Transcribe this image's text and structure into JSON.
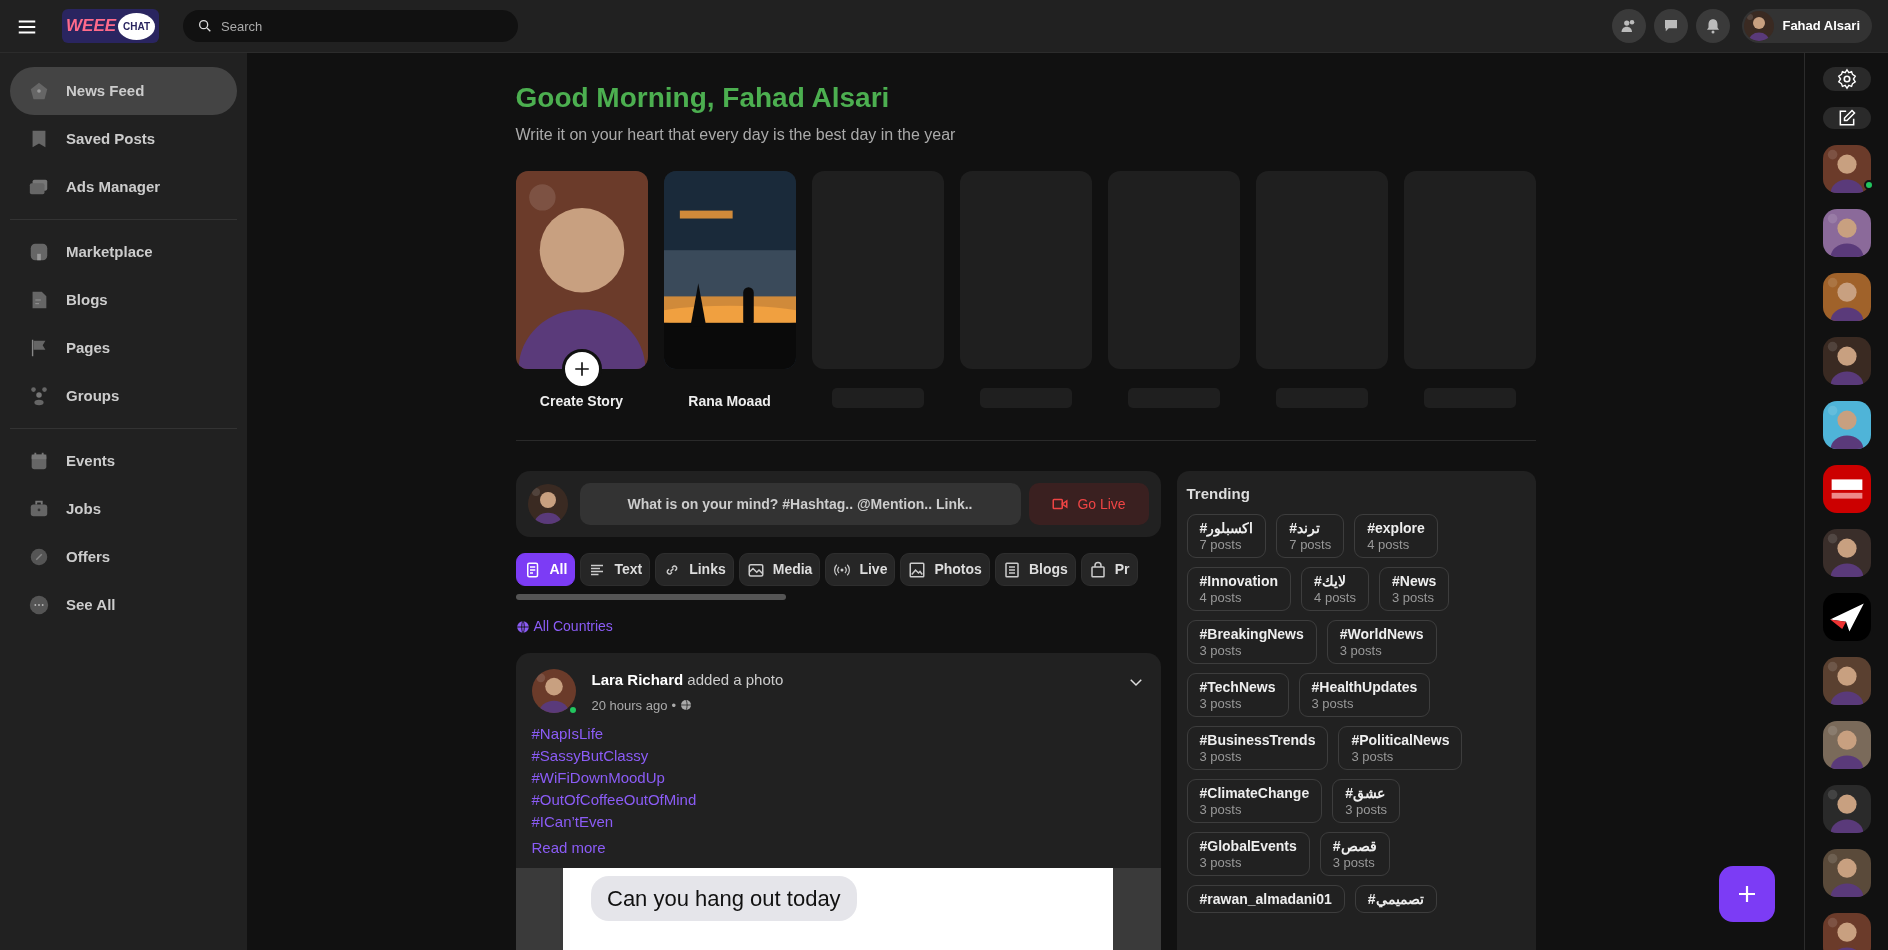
{
  "topbar": {
    "logo": {
      "word1": "WEEE",
      "word2": "CHAT"
    },
    "search": {
      "placeholder": "Search"
    },
    "user_name": "Fahad Alsari"
  },
  "sidebar": {
    "groups": [
      [
        {
          "label": "News Feed",
          "selected": true
        },
        {
          "label": "Saved Posts",
          "selected": false
        },
        {
          "label": "Ads Manager",
          "selected": false
        }
      ],
      [
        {
          "label": "Marketplace",
          "selected": false
        },
        {
          "label": "Blogs",
          "selected": false
        },
        {
          "label": "Pages",
          "selected": false
        },
        {
          "label": "Groups",
          "selected": false
        }
      ],
      [
        {
          "label": "Events",
          "selected": false
        },
        {
          "label": "Jobs",
          "selected": false
        },
        {
          "label": "Offers",
          "selected": false
        },
        {
          "label": "See All",
          "selected": false
        }
      ]
    ]
  },
  "greeting": {
    "title": "Good Morning, Fahad Alsari",
    "subtitle": "Write it on your heart that every day is the best day in the year"
  },
  "stories": [
    {
      "kind": "create",
      "label": "Create Story"
    },
    {
      "kind": "story",
      "label": "Rana Moaad"
    },
    {
      "kind": "placeholder"
    },
    {
      "kind": "placeholder"
    },
    {
      "kind": "placeholder"
    },
    {
      "kind": "placeholder"
    },
    {
      "kind": "placeholder"
    }
  ],
  "composer": {
    "placeholder": "What is on your mind? #Hashtag.. @Mention.. Link..",
    "live_button": "Go Live"
  },
  "feed_tabs": [
    {
      "label": "All",
      "selected": true
    },
    {
      "label": "Text",
      "selected": false
    },
    {
      "label": "Links",
      "selected": false
    },
    {
      "label": "Media",
      "selected": false
    },
    {
      "label": "Live",
      "selected": false
    },
    {
      "label": "Photos",
      "selected": false
    },
    {
      "label": "Blogs",
      "selected": false
    },
    {
      "label": "Pr",
      "selected": false
    }
  ],
  "country_filter": "All Countries",
  "post": {
    "header": "**Lara Richard** added a photo",
    "online": true,
    "time": "20 hours ago",
    "separator": "•",
    "hashtags": [
      "#NapIsLife",
      "#SassyButClassy",
      "#WiFiDownMoodUp",
      "#OutOfCoffeeOutOfMind",
      "#ICan’tEven"
    ],
    "read_more": "Read more",
    "image": {
      "message": "Can you hang out today"
    }
  },
  "trending": {
    "title": "Trending",
    "tags": [
      {
        "tag": "#اكسبلور",
        "posts": "7 posts"
      },
      {
        "tag": "#ترند",
        "posts": "7 posts"
      },
      {
        "tag": "#explore",
        "posts": "4 posts"
      },
      {
        "tag": "#Innovation",
        "posts": "4 posts"
      },
      {
        "tag": "#لايك",
        "posts": "4 posts"
      },
      {
        "tag": "#News",
        "posts": "3 posts"
      },
      {
        "tag": "#BreakingNews",
        "posts": "3 posts"
      },
      {
        "tag": "#WorldNews",
        "posts": "3 posts"
      },
      {
        "tag": "#TechNews",
        "posts": "3 posts"
      },
      {
        "tag": "#HealthUpdates",
        "posts": "3 posts"
      },
      {
        "tag": "#BusinessTrends",
        "posts": "3 posts"
      },
      {
        "tag": "#PoliticalNews",
        "posts": "3 posts"
      },
      {
        "tag": "#ClimateChange",
        "posts": "3 posts"
      },
      {
        "tag": "#عشق",
        "posts": "3 posts"
      },
      {
        "tag": "#GlobalEvents",
        "posts": "3 posts"
      },
      {
        "tag": "#قصص",
        "posts": "3 posts"
      },
      {
        "tag": "#rawan_almadani01"
      },
      {
        "tag": "#تصميمي"
      }
    ]
  },
  "contacts": [
    {
      "online": true
    },
    {
      "online": false
    },
    {
      "online": false
    },
    {
      "online": false
    },
    {
      "online": false
    },
    {
      "online": false
    },
    {
      "online": false
    },
    {
      "online": false
    },
    {
      "online": false
    },
    {
      "online": false
    },
    {
      "online": false
    },
    {
      "online": false
    },
    {
      "online": false
    }
  ]
}
